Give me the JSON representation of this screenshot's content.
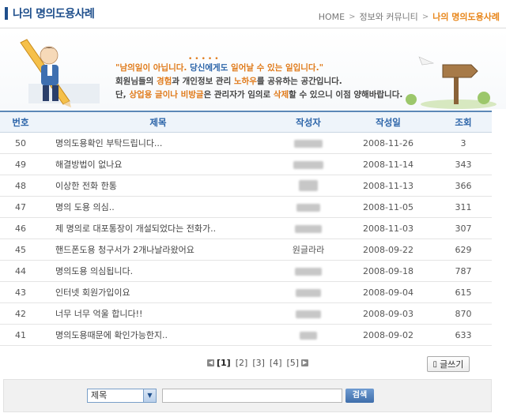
{
  "header": {
    "title": "나의 명의도용사례",
    "breadcrumb": [
      "HOME",
      "정보와 커뮤니티",
      "나의 명의도용사례"
    ]
  },
  "banner": {
    "line1_a": "\"남의일이 아닙니다. ",
    "line1_b": "당신에게도",
    "line1_c": " 일어날 수 있는 일입니다.\"",
    "line2_a": "회원님들의 ",
    "line2_b": "경험",
    "line2_c": "과 개인정보 관리 ",
    "line2_d": "노하우",
    "line2_e": "를 공유하는 공간입니다.",
    "line3_a": "단, ",
    "line3_b": "상업용 글이나 비방글",
    "line3_c": "은 관리자가 임의로 ",
    "line3_d": "삭제",
    "line3_e": "할 수 있으니 이점 양해바랍니다."
  },
  "table": {
    "columns": [
      "번호",
      "제목",
      "작성자",
      "작성일",
      "조회"
    ],
    "rows": [
      {
        "no": "50",
        "title": "명의도용확인 부탁드립니다...",
        "author": "",
        "date": "2008-11-26",
        "views": "3"
      },
      {
        "no": "49",
        "title": "해결방법이 없나요",
        "author": "",
        "date": "2008-11-14",
        "views": "343"
      },
      {
        "no": "48",
        "title": "이상한 전화 한통",
        "author": "",
        "date": "2008-11-13",
        "views": "366"
      },
      {
        "no": "47",
        "title": "명의 도용 의심..",
        "author": "",
        "date": "2008-11-05",
        "views": "311"
      },
      {
        "no": "46",
        "title": "제 명의로 대포통장이 개설되었다는 전화가..",
        "author": "",
        "date": "2008-11-03",
        "views": "307"
      },
      {
        "no": "45",
        "title": "핸드폰도용 청구서가 2개나날라왔어요",
        "author": "원글라라",
        "date": "2008-09-22",
        "views": "629"
      },
      {
        "no": "44",
        "title": "명의도용 의심됩니다.",
        "author": "",
        "date": "2008-09-18",
        "views": "787"
      },
      {
        "no": "43",
        "title": "인터넷 회원가입이요",
        "author": "",
        "date": "2008-09-04",
        "views": "615"
      },
      {
        "no": "42",
        "title": "너무 너무 억울 합니다!!",
        "author": "",
        "date": "2008-09-03",
        "views": "870"
      },
      {
        "no": "41",
        "title": "명의도용때문에 확인가능한지..",
        "author": "",
        "date": "2008-09-02",
        "views": "633"
      }
    ]
  },
  "pagination": {
    "pages": [
      "[1]",
      "[2]",
      "[3]",
      "[4]",
      "[5]"
    ],
    "current": "[1]"
  },
  "write_button": "글쓰기",
  "search": {
    "field_selected": "제목",
    "button": "검색",
    "value": ""
  },
  "colors": {
    "title": "#1f4f8c",
    "accent_orange": "#e07a1a",
    "header_blue": "#2a63a8"
  }
}
